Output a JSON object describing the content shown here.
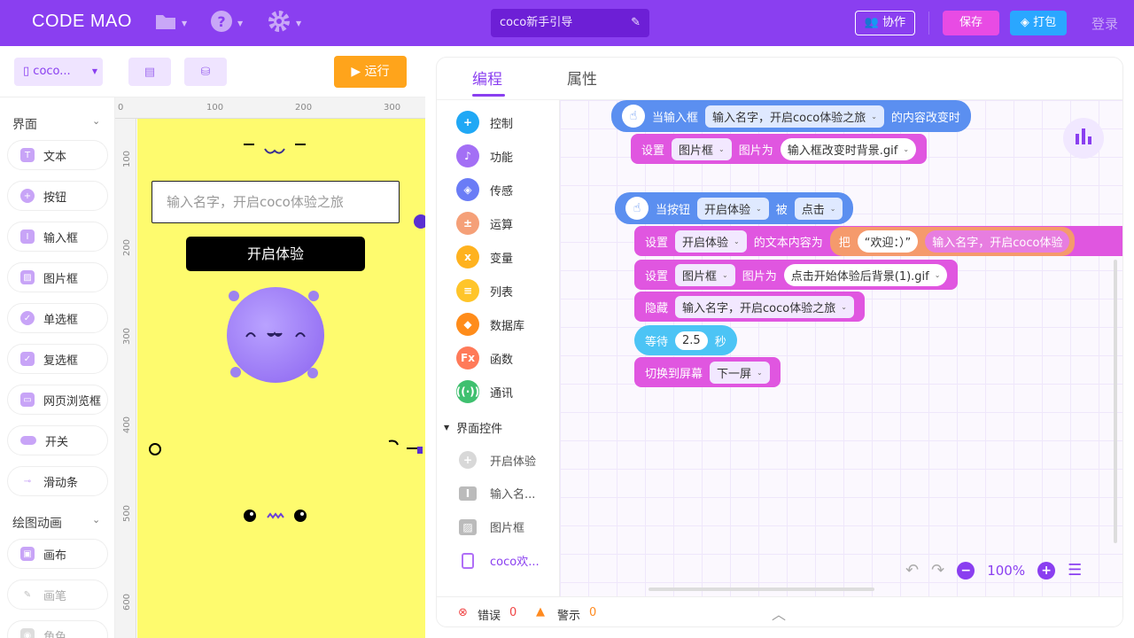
{
  "header": {
    "logo": "CODE MAO",
    "project_name": "coco新手引导",
    "collab_label": "协作",
    "save_label": "保存",
    "pack_label": "打包",
    "login_label": "登录"
  },
  "toolbar": {
    "device_label": "coco...",
    "run_label": "运行"
  },
  "left": {
    "section_ui": "界面",
    "widgets": [
      "文本",
      "按钮",
      "输入框",
      "图片框",
      "单选框",
      "复选框",
      "网页浏览框",
      "开关",
      "滑动条"
    ],
    "section_draw": "绘图动画",
    "draw_widgets": [
      "画布",
      "画笔",
      "角色"
    ]
  },
  "ruler": {
    "top": [
      "0",
      "100",
      "200",
      "300"
    ],
    "left": [
      "100",
      "200",
      "300",
      "400",
      "500",
      "600"
    ]
  },
  "stage": {
    "input_placeholder": "输入名字，开启coco体验之旅",
    "button_label": "开启体验"
  },
  "editor": {
    "tabs": [
      "编程",
      "属性"
    ],
    "categories": [
      "控制",
      "功能",
      "传感",
      "运算",
      "变量",
      "列表",
      "数据库",
      "函数",
      "通讯"
    ],
    "cat_colors": [
      "#20a8f5",
      "#a36ff5",
      "#6a7cf6",
      "#f5a078",
      "#ffb21f",
      "#ffc52a",
      "#ff8c1a",
      "#ff7a59",
      "#3fc06f"
    ],
    "ui_section": "界面控件",
    "ui_items": [
      "开启体验",
      "输入名...",
      "图片框",
      "coco欢..."
    ],
    "blocks": {
      "b1": {
        "when": "当输入框",
        "target": "输入名字，开启coco体验之旅",
        "tail": "的内容改变时"
      },
      "b2": {
        "set": "设置",
        "comp": "图片框",
        "mid": "图片为",
        "value": "输入框改变时背景.gif"
      },
      "b3": {
        "when": "当按钮",
        "target": "开启体验",
        "mid": "被",
        "action": "点击"
      },
      "b4": {
        "set": "设置",
        "comp": "开启体验",
        "mid": "的文本内容为",
        "join": "把",
        "str": "“欢迎：）”",
        "tail": "输入名字，开启coco体验"
      },
      "b5": {
        "set": "设置",
        "comp": "图片框",
        "mid": "图片为",
        "value": "点击开始体验后背景(1).gif"
      },
      "b6": {
        "hide": "隐藏",
        "target": "输入名字，开启coco体验之旅"
      },
      "b7": {
        "wait": "等待",
        "value": "2.5",
        "unit": "秒"
      },
      "b8": {
        "switch": "切换到屏幕",
        "target": "下一屏"
      }
    },
    "zoom": "100%",
    "errors_label": "错误",
    "errors_count": "0",
    "warn_label": "警示",
    "warn_count": "0"
  }
}
